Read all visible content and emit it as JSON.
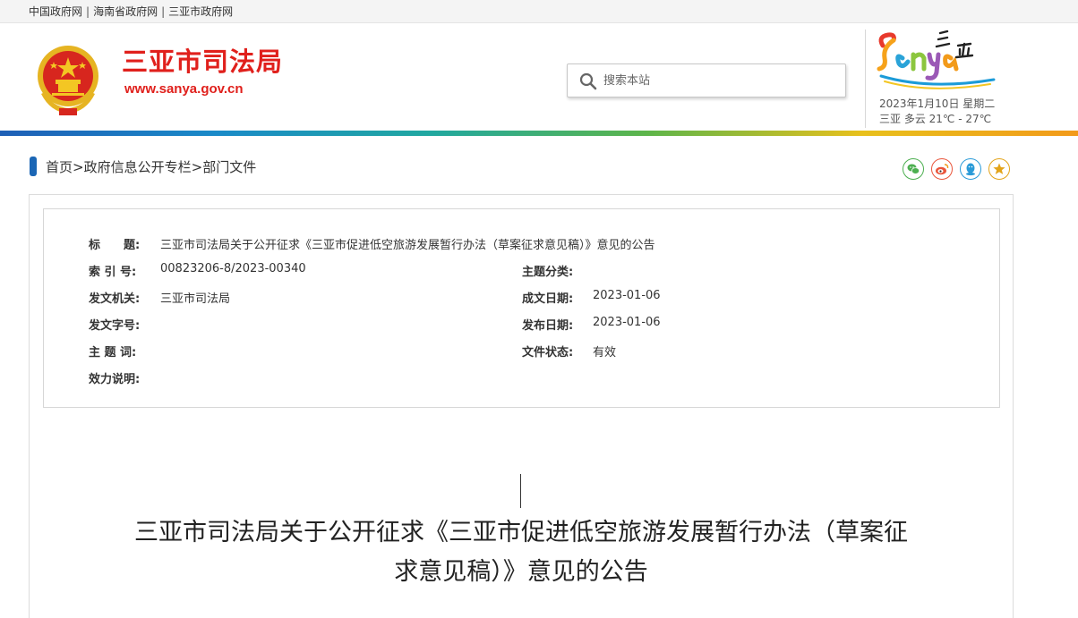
{
  "top_links": [
    "中国政府网",
    "海南省政府网",
    "三亚市政府网"
  ],
  "header": {
    "site_name": "三亚市司法局",
    "site_url": "www.sanya.gov.cn",
    "search_placeholder": "搜索本站",
    "logo_text": "Sanya 三亚",
    "date": "2023年1月10日 星期二",
    "weather": "三亚  多云  21℃ - 27℃"
  },
  "breadcrumb": {
    "home": "首页",
    "section": "政府信息公开专栏",
    "current": "部门文件",
    "sep": ">"
  },
  "share_icons": [
    "wechat-icon",
    "weibo-icon",
    "qq-icon",
    "favorite-icon"
  ],
  "colors": {
    "brand_red": "#e0201c",
    "accent_blue": "#1b66b5",
    "wechat_green": "#4caf50",
    "weibo_orange": "#e9553b",
    "qq_blue": "#2b9bd8",
    "star_gold": "#e3a41a"
  },
  "meta": {
    "title_label": "标　　题:",
    "title_value": "三亚市司法局关于公开征求《三亚市促进低空旅游发展暂行办法（草案征求意见稿）》意见的公告",
    "index_label": "索 引 号:",
    "index_value": "00823206-8/2023-00340",
    "category_label": "主题分类:",
    "category_value": "",
    "issuer_label": "发文机关:",
    "issuer_value": "三亚市司法局",
    "created_label": "成文日期:",
    "created_value": "2023-01-06",
    "docno_label": "发文字号:",
    "docno_value": "",
    "published_label": "发布日期:",
    "published_value": "2023-01-06",
    "keywords_label": "主 题 词:",
    "keywords_value": "",
    "status_label": "文件状态:",
    "status_value": "有效",
    "validity_label": "效力说明:",
    "validity_value": ""
  },
  "document": {
    "title_line1": "三亚市司法局关于公开征求《三亚市促进低空旅游发展暂行办法（草案征",
    "title_line2": "求意见稿）》意见的公告"
  }
}
